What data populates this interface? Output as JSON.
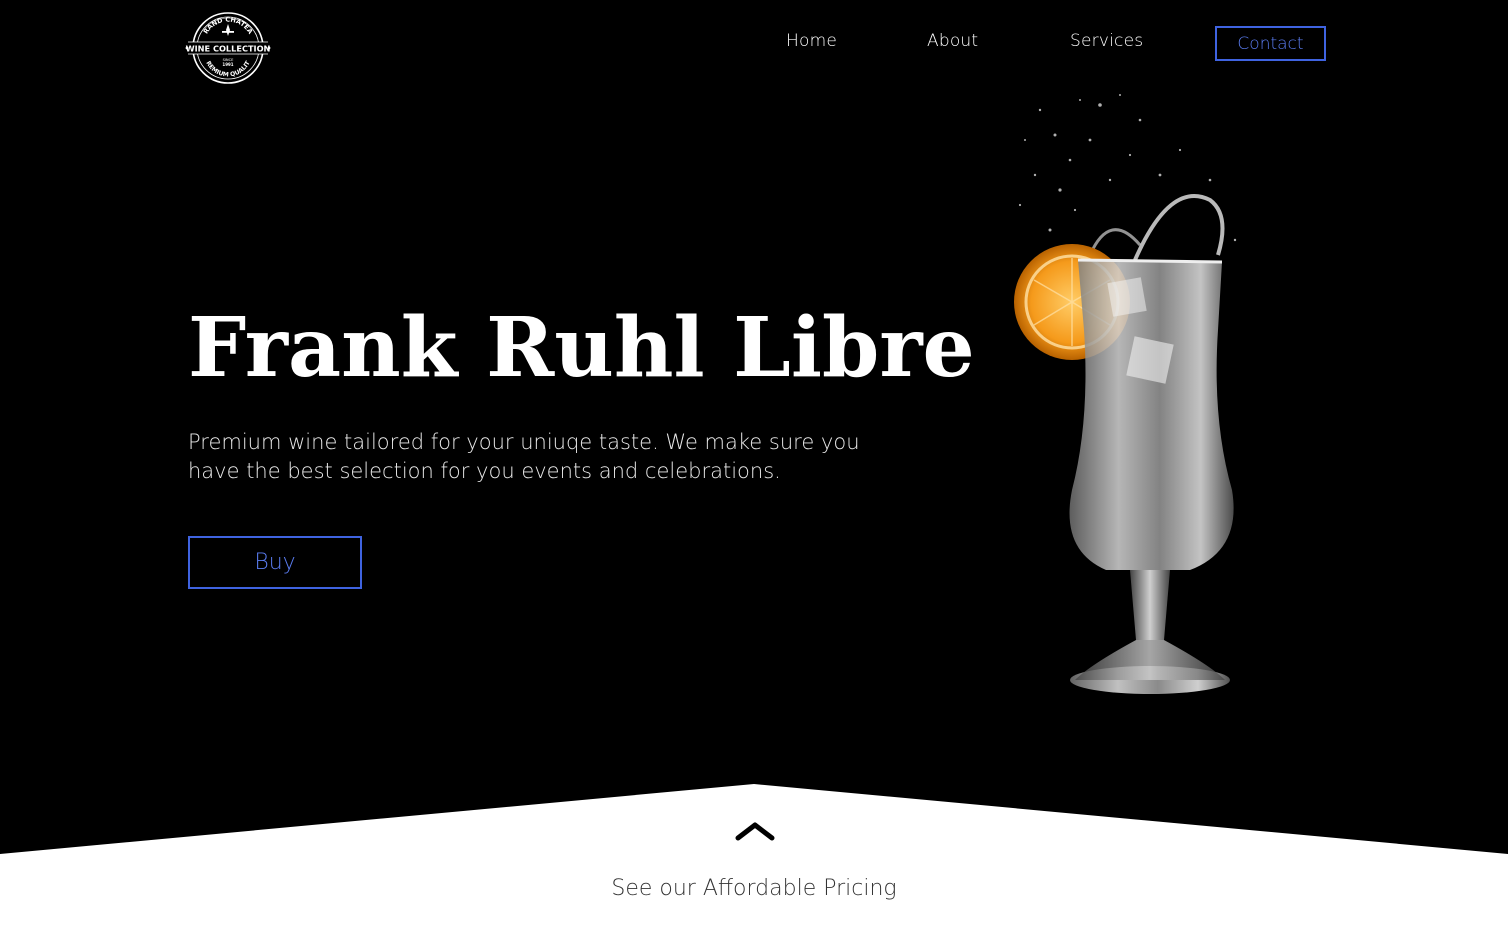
{
  "logo": {
    "top_text": "GRAND CHATEAU",
    "main_text": "WINE COLLECTION",
    "since_text": "SINCE",
    "year_text": "1991",
    "bottom_text": "PREMIUM QUALITY"
  },
  "nav": {
    "home": "Home",
    "about": "About",
    "services": "Services",
    "contact": "Contact"
  },
  "hero": {
    "headline": "Frank Ruhl Libre",
    "tagline": "Premium wine tailored for your uniuqe taste. We make sure you have the best selection for you events and celebrations.",
    "buy_label": "Buy"
  },
  "bottom": {
    "chevron_icon": "chevron-up-icon",
    "pricing_label": "See our Affordable Pricing"
  },
  "colors": {
    "accent": "#3f63e0",
    "background": "#000000",
    "text": "#ffffff"
  }
}
